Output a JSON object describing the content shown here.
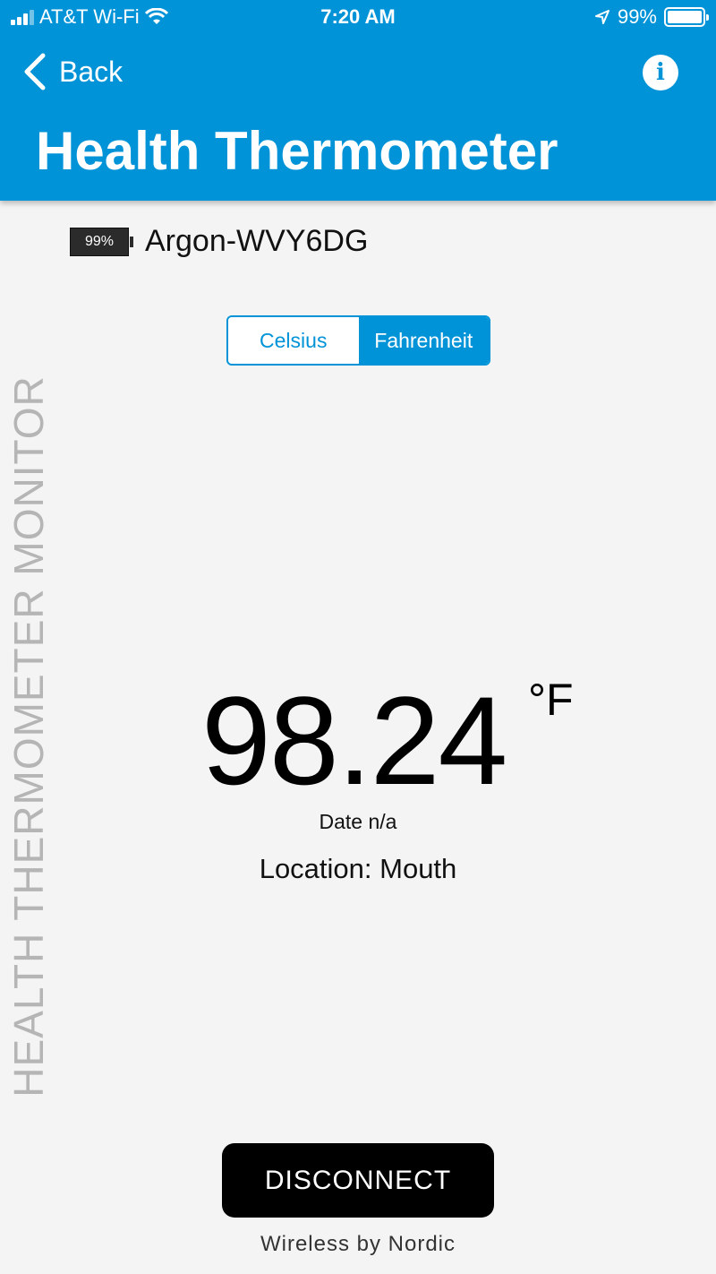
{
  "status_bar": {
    "carrier": "AT&T Wi-Fi",
    "time": "7:20 AM",
    "battery": "99%",
    "icons": [
      "signal-icon",
      "wifi-icon",
      "location-icon",
      "battery-icon"
    ]
  },
  "header": {
    "back_label": "Back",
    "info_icon": "i",
    "title": "Health Thermometer",
    "color": "#0093d8"
  },
  "device": {
    "battery": "99%",
    "name": "Argon-WVY6DG"
  },
  "units": {
    "options": [
      "Celsius",
      "Fahrenheit"
    ],
    "selected": "Fahrenheit"
  },
  "side_label": "HEALTH THERMOMETER MONITOR",
  "reading": {
    "value": "98.24",
    "unit": "°F",
    "date": "Date n/a",
    "location": "Location: Mouth"
  },
  "disconnect_label": "DISCONNECT",
  "footer": "Wireless by Nordic"
}
